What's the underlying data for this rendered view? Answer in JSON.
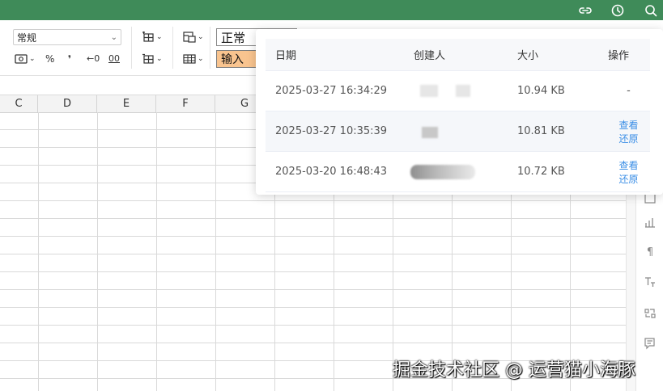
{
  "toolbar": {
    "number_format": "常规",
    "percent": "%",
    "comma": "❜",
    "dec_decrease": "←0",
    "dec_increase": "00",
    "style_normal": "正常",
    "style_input": "输入"
  },
  "columns": [
    "C",
    "D",
    "E",
    "F",
    "G"
  ],
  "history": {
    "headers": {
      "date": "日期",
      "creator": "创建人",
      "size": "大小",
      "actions": "操作"
    },
    "rows": [
      {
        "date": "2025-03-27 16:34:29",
        "size": "10.94 KB",
        "action_text": "-",
        "view": "",
        "restore": ""
      },
      {
        "date": "2025-03-27 10:35:39",
        "size": "10.81 KB",
        "action_text": "",
        "view": "查看",
        "restore": "还原"
      },
      {
        "date": "2025-03-20 16:48:43",
        "size": "10.72 KB",
        "action_text": "",
        "view": "查看",
        "restore": "还原"
      }
    ]
  },
  "watermark": "掘金技术社区 @ 运营猫小海豚",
  "colors": {
    "brand": "#3f8b59",
    "link": "#3a8ee6",
    "style_input_bg": "#f9c48f"
  },
  "icons": {
    "topbar": [
      "link-icon",
      "history-icon",
      "search-icon"
    ],
    "side": [
      "chart-icon",
      "paragraph-icon",
      "text-style-icon",
      "shuffle-icon",
      "comment-icon"
    ]
  }
}
